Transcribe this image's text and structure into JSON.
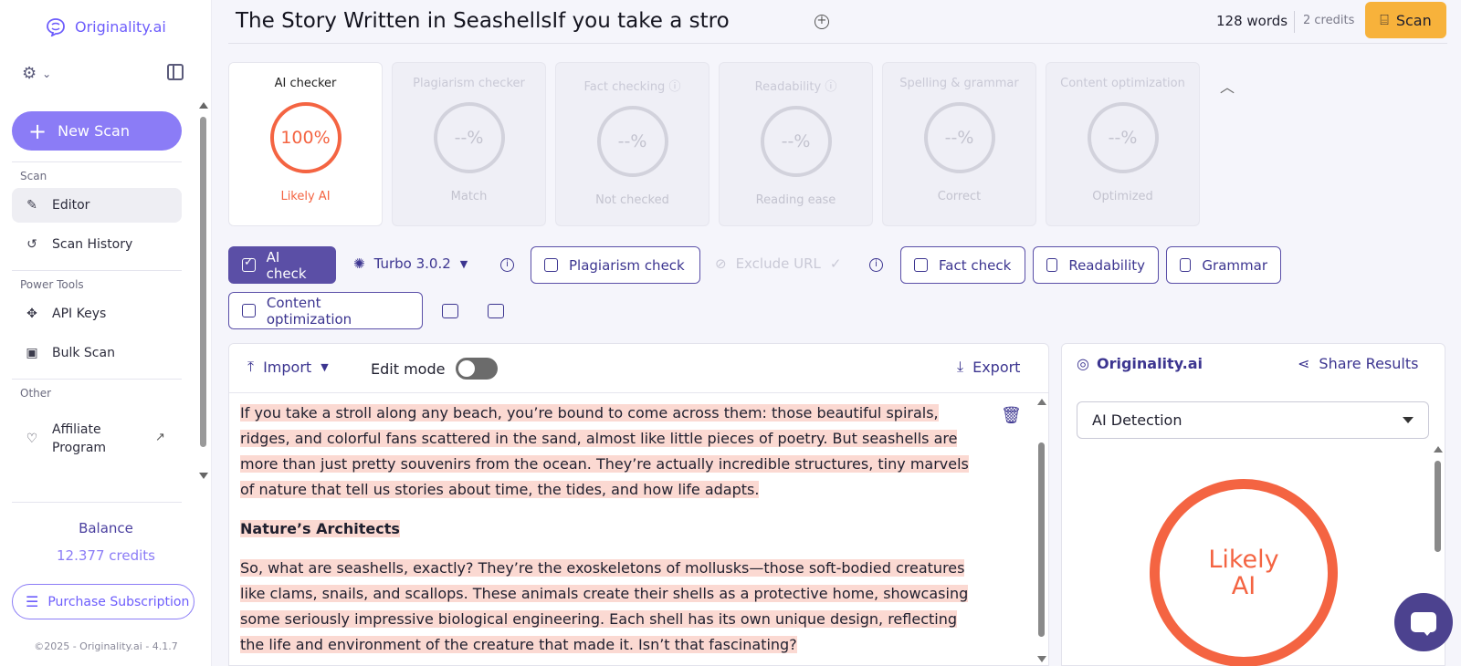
{
  "app": {
    "brand": "Originality.ai"
  },
  "sidebar": {
    "new_scan": "New Scan",
    "sections": [
      "Scan",
      "Power Tools",
      "Other"
    ],
    "items": [
      {
        "label": "Editor",
        "icon": "pencil-icon"
      },
      {
        "label": "Scan History",
        "icon": "history-icon"
      },
      {
        "label": "API Keys",
        "icon": "api-keys-icon"
      },
      {
        "label": "Bulk Scan",
        "icon": "bulk-scan-icon"
      },
      {
        "label": "Affiliate",
        "label2": "Program",
        "icon": "heart-icon"
      }
    ],
    "balance_title": "Balance",
    "balance_credits": "12.377 credits",
    "purchase": "Purchase Subscription",
    "copyright": "©2025 - Originality.ai - 4.1.7"
  },
  "header": {
    "title": "The Story Written in SeashellsIf you take a stro",
    "words": "128 words",
    "credits": "2 credits",
    "scan": "Scan"
  },
  "cards": [
    {
      "title": "AI checker",
      "value": "100%",
      "sub": "Likely AI"
    },
    {
      "title": "Plagiarism checker",
      "value": "--%",
      "sub": "Match"
    },
    {
      "title": "Fact checking",
      "value": "--%",
      "sub": "Not checked"
    },
    {
      "title": "Readability",
      "value": "--%",
      "sub": "Reading ease"
    },
    {
      "title": "Spelling & grammar",
      "value": "--%",
      "sub": "Correct"
    },
    {
      "title": "Content optimization",
      "value": "--%",
      "sub": "Optimized"
    }
  ],
  "options": {
    "ai_check": "AI check",
    "model": "Turbo 3.0.2",
    "plagiarism": "Plagiarism check",
    "exclude_url": "Exclude URL",
    "fact": "Fact check",
    "readability": "Readability",
    "grammar": "Grammar",
    "content_opt": "Content optimization"
  },
  "editor": {
    "import": "Import",
    "edit_mode": "Edit mode",
    "export": "Export",
    "p1": "If you take a stroll along any beach, you’re bound to come across them: those beautiful spirals, ridges, and colorful fans scattered in the sand, almost like little pieces of poetry. But seashells are more than just pretty souvenirs from the ocean. They’re actually incredible structures, tiny marvels of nature that tell us stories about time, the tides, and how life adapts.",
    "h1": "Nature’s Architects",
    "p2": "So, what are seashells, exactly? They’re the exoskeletons of mollusks—those soft-bodied creatures like clams, snails, and scallops. These animals create their shells as a protective home, showcasing some seriously impressive biological engineering. Each shell has its own unique design, reflecting the life and environment of the creature that made it. Isn’t that fascinating?"
  },
  "results": {
    "brand": "Originality.ai",
    "share": "Share Results",
    "select": "AI Detection",
    "verdict_1": "Likely",
    "verdict_2": "AI"
  },
  "colors": {
    "accent": "#6d5dfc",
    "ai_red": "#f46442",
    "scan_orange": "#f7b23b",
    "highlight": "#fbd9d2"
  }
}
